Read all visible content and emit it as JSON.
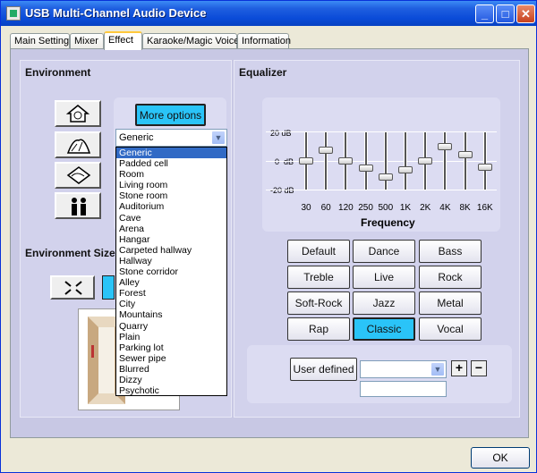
{
  "window": {
    "title": "USB Multi-Channel Audio Device",
    "min_glyph": "_",
    "max_glyph": "□",
    "close_glyph": "✕"
  },
  "tabs": [
    {
      "label": "Main Setting"
    },
    {
      "label": "Mixer"
    },
    {
      "label": "Effect"
    },
    {
      "label": "Karaoke/Magic Voice"
    },
    {
      "label": "Information"
    }
  ],
  "active_tab": "Effect",
  "environment": {
    "title": "Environment",
    "more_options": "More options",
    "selected": "Generic",
    "options": [
      "Generic",
      "Padded cell",
      "Room",
      "Living room",
      "Stone room",
      "Auditorium",
      "Cave",
      "Arena",
      "Hangar",
      "Carpeted hallway",
      "Hallway",
      "Stone corridor",
      "Alley",
      "Forest",
      "City",
      "Mountains",
      "Quarry",
      "Plain",
      "Parking lot",
      "Sewer pipe",
      "Blurred",
      "Dizzy",
      "Psychotic"
    ],
    "icons": [
      "house-icon",
      "concert-hall-icon",
      "landscape-icon",
      "people-icon"
    ]
  },
  "environment_size": {
    "title": "Environment Size",
    "shrink_icon": "arrows-inward-icon"
  },
  "equalizer": {
    "title": "Equalizer",
    "db_top": "20",
    "db_mid": "0",
    "db_bottom": "-20",
    "db_unit": "dB",
    "frequency_label": "Frequency",
    "bands": [
      {
        "label": "30",
        "value": 0
      },
      {
        "label": "60",
        "value": 7
      },
      {
        "label": "120",
        "value": 0
      },
      {
        "label": "250",
        "value": -5
      },
      {
        "label": "500",
        "value": -11
      },
      {
        "label": "1K",
        "value": -6
      },
      {
        "label": "2K",
        "value": 0
      },
      {
        "label": "4K",
        "value": 10
      },
      {
        "label": "8K",
        "value": 4
      },
      {
        "label": "16K",
        "value": -4
      }
    ],
    "presets": [
      "Default",
      "Dance",
      "Bass",
      "Treble",
      "Live",
      "Rock",
      "Soft-Rock",
      "Jazz",
      "Metal",
      "Rap",
      "Classic",
      "Vocal"
    ],
    "active_preset": "Classic",
    "user_defined": "User defined",
    "user_select_value": "",
    "user_name_value": "",
    "plus": "+",
    "minus": "−"
  },
  "ok_button": "OK"
}
